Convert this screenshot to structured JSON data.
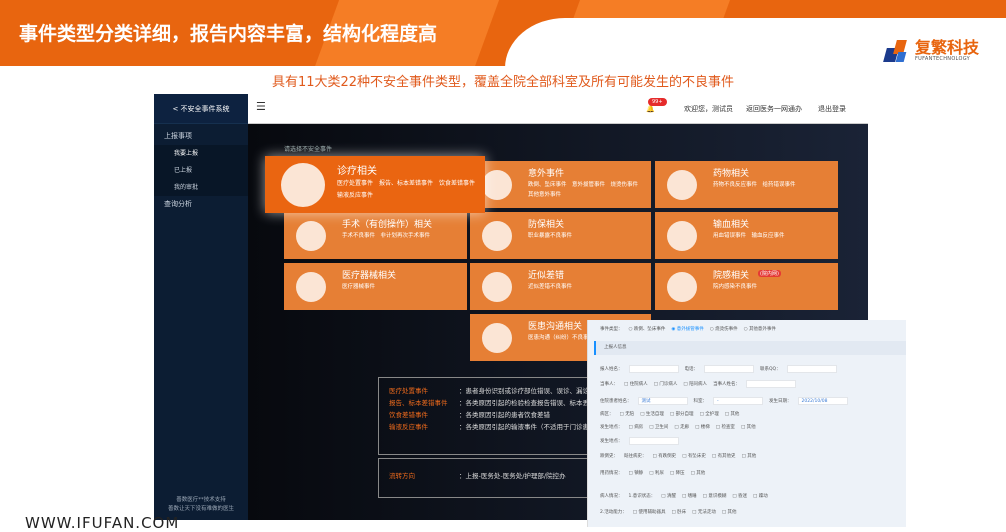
{
  "slide": {
    "title": "事件类型分类详细，报告内容丰富，结构化程度高",
    "subtitle": "具有11大类22种不安全事件类型，覆盖全院全部科室及所有可能发生的不良事件",
    "logo_cn": "复繁科技",
    "logo_en": "FUFANTECHNOLOGY",
    "footer_url": "WWW.IFUFAN.COM",
    "accent": "#e8650f"
  },
  "app": {
    "sidebar": {
      "back": "< 不安全事件系统",
      "group": "上报事项",
      "items": [
        "我要上报",
        "已上报",
        "我的审批"
      ],
      "analysis": "查询分析",
      "footer": [
        "善数医疗**技术支持",
        "善数让天下没有难做的医生"
      ]
    },
    "topbar": {
      "badge": "99+",
      "welcome": "欢迎您，测试员",
      "back_portal": "返回医务一网通办",
      "logout": "退出登录"
    },
    "hint": "请选择不安全事件",
    "cards": [
      {
        "name": "诊疗相关",
        "desc": "医疗处置事件　报告、标本差错事件　饮食差错事件　输液反应事件"
      },
      {
        "name": "意外事件",
        "desc": "跌倒、坠床事件　意外拔管事件　烧烫伤事件　其他意外事件"
      },
      {
        "name": "药物相关",
        "desc": "药物不良反应事件　给药错误事件"
      },
      {
        "name": "手术（有创操作）相关",
        "desc": "手术不良事件　非计划再次手术事件"
      },
      {
        "name": "防保相关",
        "desc": "职业暴露不良事件"
      },
      {
        "name": "输血相关",
        "desc": "用血错误事件　输血反应事件"
      },
      {
        "name": "医疗器械相关",
        "desc": "医疗器械事件"
      },
      {
        "name": "近似差错",
        "desc": "近似差错不良事件"
      },
      {
        "name": "院感相关",
        "tag": "(院内网)",
        "desc": "院内感染不良事件"
      },
      {
        "name": "医患沟通相关",
        "desc": "医患沟通（纠纷）不良事件"
      }
    ],
    "details": [
      {
        "k": "医疗处置事件",
        "v": "：患者身份识别或诊疗部位错误、误诊、漏诊、错误治疗、技术操作失误等"
      },
      {
        "k": "报告、标本差错事件",
        "v": "：各类原因引起的检验检查报告错误、标本丢失"
      },
      {
        "k": "饮食差错事件",
        "v": "：各类原因引起的患者饮食差错"
      },
      {
        "k": "输液反应事件",
        "v": "：各类原因引起的输液事件（不适用于门诊患者）"
      }
    ],
    "flow": {
      "k": "流转方向",
      "v": "：上报-医务处-医务处/护理部/院控办"
    }
  },
  "form": {
    "type_label": "事件类型：",
    "types": [
      "跌倒、坠床事件",
      "意外拔管事件",
      "烧烫伤事件",
      "其他意外事件"
    ],
    "section": "上报人信息",
    "r1": [
      "报人姓名：",
      "电话：",
      "联系QQ："
    ],
    "r2": [
      "当事人：",
      "住院病人",
      "门诊病人",
      "陪同病人",
      "当事人姓名："
    ],
    "r3": [
      "住院患者姓名：",
      "测试",
      "科室：",
      "-",
      "发生日期：",
      "2022/10/08"
    ],
    "r4": [
      "病区：",
      "无陪",
      "生活自理",
      "部分自理",
      "全护理",
      "其他"
    ],
    "r5": [
      "发生地点：",
      "病房",
      "卫生间",
      "走廊",
      "楼梯",
      "检查室",
      "其他"
    ],
    "r6": [
      "发生地点："
    ],
    "r7": [
      "跌倒史：",
      "既往病史：",
      "有跌倒史",
      "有坠床史",
      "有其他史",
      "其他"
    ],
    "r8": [
      "用药情况：",
      "镇静",
      "利尿",
      "降压",
      "其他"
    ],
    "r9": [
      "病人情况：",
      "1.意识状态：",
      "清醒",
      "嗜睡",
      "意识模糊",
      "昏迷",
      "躁动"
    ],
    "r10": [
      "2.活动能力：",
      "使用辅助器具",
      "卧床",
      "无法走动",
      "其他"
    ]
  }
}
